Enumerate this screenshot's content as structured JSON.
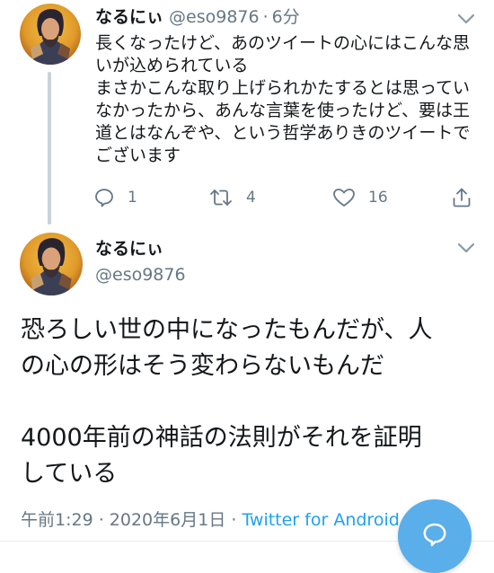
{
  "colors": {
    "accent": "#1da1f2",
    "secondary_text": "#657786",
    "primary_text": "#14171a",
    "thread_line": "#c8d2da",
    "fab": "#5aaeea"
  },
  "reply_tweet": {
    "display_name": "なるにぃ",
    "handle": "@eso9876",
    "separator": "·",
    "time": "6分",
    "body_lines": [
      "長くなったけど、あのツイートの心にはこんな思",
      "いが込められている",
      "まさかこんな取り上げられかたするとは思ってい",
      "なかったから、あんな言葉を使ったけど、要は王",
      "道とはなんぞや、という哲学ありきのツイートで",
      "ございます"
    ],
    "actions": {
      "reply_count": "1",
      "retweet_count": "4",
      "like_count": "16"
    },
    "icons": [
      "reply-icon",
      "retweet-icon",
      "like-icon",
      "share-icon",
      "chevron-down-icon"
    ]
  },
  "main_tweet": {
    "display_name": "なるにぃ",
    "handle": "@eso9876",
    "body_lines": [
      "恐ろしい世の中になったもんだが、人",
      "の心の形はそう変わらないもんだ",
      "",
      "4000年前の神話の法則がそれを証明",
      "している"
    ],
    "timestamp": "午前1:29 · 2020年6月1日 · ",
    "source": "Twitter for Android"
  },
  "compose_button": {
    "icon": "compose-reply-icon"
  }
}
